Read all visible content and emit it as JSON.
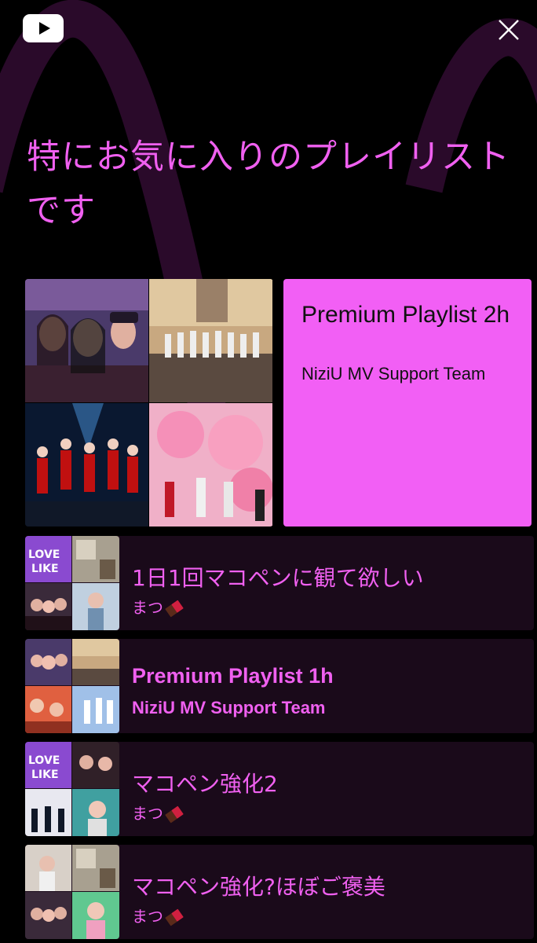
{
  "header": {
    "logo_icon": "youtube-logo-icon",
    "close_icon": "close-icon"
  },
  "headline": "特にお気に入りのプレイリストです",
  "featured": {
    "title": "Premium Playlist 2h",
    "author": "NiziU MV Support Team"
  },
  "playlists": [
    {
      "title": "1日1回マコペンに観て欲しい",
      "author": "まつ",
      "author_icon": "chocolate-icon"
    },
    {
      "title": "Premium Playlist 1h",
      "author": "NiziU MV Support Team"
    },
    {
      "title": "マコペン強化2",
      "author": "まつ",
      "author_icon": "chocolate-icon"
    },
    {
      "title": "マコペン強化?ほぼご褒美",
      "author": "まつ",
      "author_icon": "chocolate-icon"
    }
  ],
  "colors": {
    "accent": "#f060f0",
    "featured_card": "#f25ff5",
    "row_background": "#1a0a1a",
    "background": "#000000"
  }
}
